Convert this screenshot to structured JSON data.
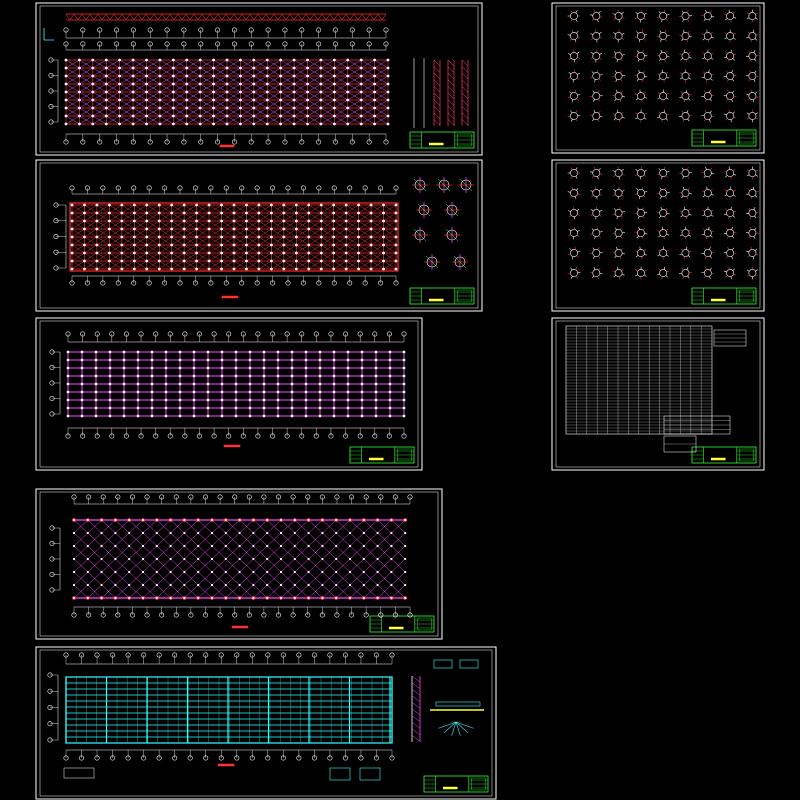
{
  "viewer": {
    "background": "#000000"
  },
  "colors": {
    "frame": "#ffffff",
    "grid_axis": "#ffffff",
    "red_member": "#ff2a2a",
    "magenta_member": "#ff44ff",
    "cyan_member": "#33ffff",
    "green_titleblock": "#33ff33",
    "yellow_text": "#ffff33",
    "orange_note": "#ff3333"
  },
  "sheets": [
    {
      "name": "sheet-1-top-elevation-and-plan",
      "content": "red-truss-grid-with-elevations"
    },
    {
      "name": "sheet-2-red-grid-plan-with-node-details",
      "content": "red-lower-chord-grid"
    },
    {
      "name": "sheet-3-magenta-grid-plan",
      "content": "magenta-upper-chord-grid"
    },
    {
      "name": "sheet-4-diagonal-web-plan",
      "content": "diagonal-web-members"
    },
    {
      "name": "sheet-5-cyan-roof-purlin-plan",
      "content": "cyan-purlin-layout"
    },
    {
      "name": "sheet-6-node-details-a",
      "content": "bolt-ball-node-detail-grid"
    },
    {
      "name": "sheet-7-node-details-b",
      "content": "bolt-ball-node-detail-grid"
    },
    {
      "name": "sheet-8-material-table",
      "content": "member-schedule-table"
    }
  ]
}
